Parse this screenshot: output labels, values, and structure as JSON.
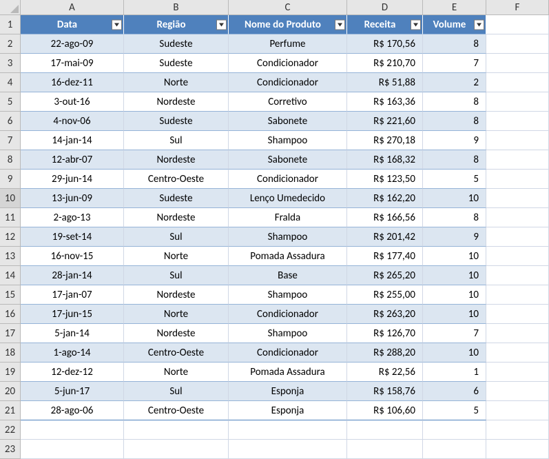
{
  "columns": [
    "A",
    "B",
    "C",
    "D",
    "E",
    "F"
  ],
  "rowNumbers": [
    "1",
    "2",
    "3",
    "4",
    "5",
    "6",
    "7",
    "8",
    "9",
    "10",
    "11",
    "12",
    "13",
    "14",
    "15",
    "16",
    "17",
    "18",
    "19",
    "20",
    "21",
    "22",
    "23"
  ],
  "activeRow": 10,
  "headers": {
    "A": "Data",
    "B": "Região",
    "C": "Nome do Produto",
    "D": "Receita",
    "E": "Volume"
  },
  "rows": [
    {
      "A": "22-ago-09",
      "B": "Sudeste",
      "C": "Perfume",
      "D": "R$ 170,56",
      "E": "8"
    },
    {
      "A": "17-mai-09",
      "B": "Sudeste",
      "C": "Condicionador",
      "D": "R$ 210,70",
      "E": "7"
    },
    {
      "A": "16-dez-11",
      "B": "Norte",
      "C": "Condicionador",
      "D": "R$ 51,88",
      "E": "2"
    },
    {
      "A": "3-out-16",
      "B": "Nordeste",
      "C": "Corretivo",
      "D": "R$ 163,36",
      "E": "8"
    },
    {
      "A": "4-nov-06",
      "B": "Sudeste",
      "C": "Sabonete",
      "D": "R$ 221,60",
      "E": "8"
    },
    {
      "A": "14-jan-14",
      "B": "Sul",
      "C": "Shampoo",
      "D": "R$ 270,18",
      "E": "9"
    },
    {
      "A": "12-abr-07",
      "B": "Nordeste",
      "C": "Sabonete",
      "D": "R$ 168,32",
      "E": "8"
    },
    {
      "A": "29-jun-14",
      "B": "Centro-Oeste",
      "C": "Condicionador",
      "D": "R$ 123,50",
      "E": "5"
    },
    {
      "A": "13-jun-09",
      "B": "Sudeste",
      "C": "Lenço Umedecido",
      "D": "R$ 162,20",
      "E": "10"
    },
    {
      "A": "2-ago-13",
      "B": "Nordeste",
      "C": "Fralda",
      "D": "R$ 166,56",
      "E": "8"
    },
    {
      "A": "19-set-14",
      "B": "Sul",
      "C": "Shampoo",
      "D": "R$ 201,42",
      "E": "9"
    },
    {
      "A": "16-nov-15",
      "B": "Norte",
      "C": "Pomada Assadura",
      "D": "R$ 177,40",
      "E": "10"
    },
    {
      "A": "28-jan-14",
      "B": "Sul",
      "C": "Base",
      "D": "R$ 265,20",
      "E": "10"
    },
    {
      "A": "17-jan-07",
      "B": "Nordeste",
      "C": "Shampoo",
      "D": "R$ 255,00",
      "E": "10"
    },
    {
      "A": "17-jun-15",
      "B": "Norte",
      "C": "Condicionador",
      "D": "R$ 263,20",
      "E": "10"
    },
    {
      "A": "5-jan-14",
      "B": "Nordeste",
      "C": "Shampoo",
      "D": "R$ 126,70",
      "E": "7"
    },
    {
      "A": "1-ago-14",
      "B": "Centro-Oeste",
      "C": "Condicionador",
      "D": "R$ 288,20",
      "E": "10"
    },
    {
      "A": "12-dez-12",
      "B": "Norte",
      "C": "Pomada Assadura",
      "D": "R$ 22,56",
      "E": "1"
    },
    {
      "A": "5-jun-17",
      "B": "Sul",
      "C": "Esponja",
      "D": "R$ 158,76",
      "E": "6"
    },
    {
      "A": "28-ago-06",
      "B": "Centro-Oeste",
      "C": "Esponja",
      "D": "R$ 106,60",
      "E": "5"
    }
  ]
}
